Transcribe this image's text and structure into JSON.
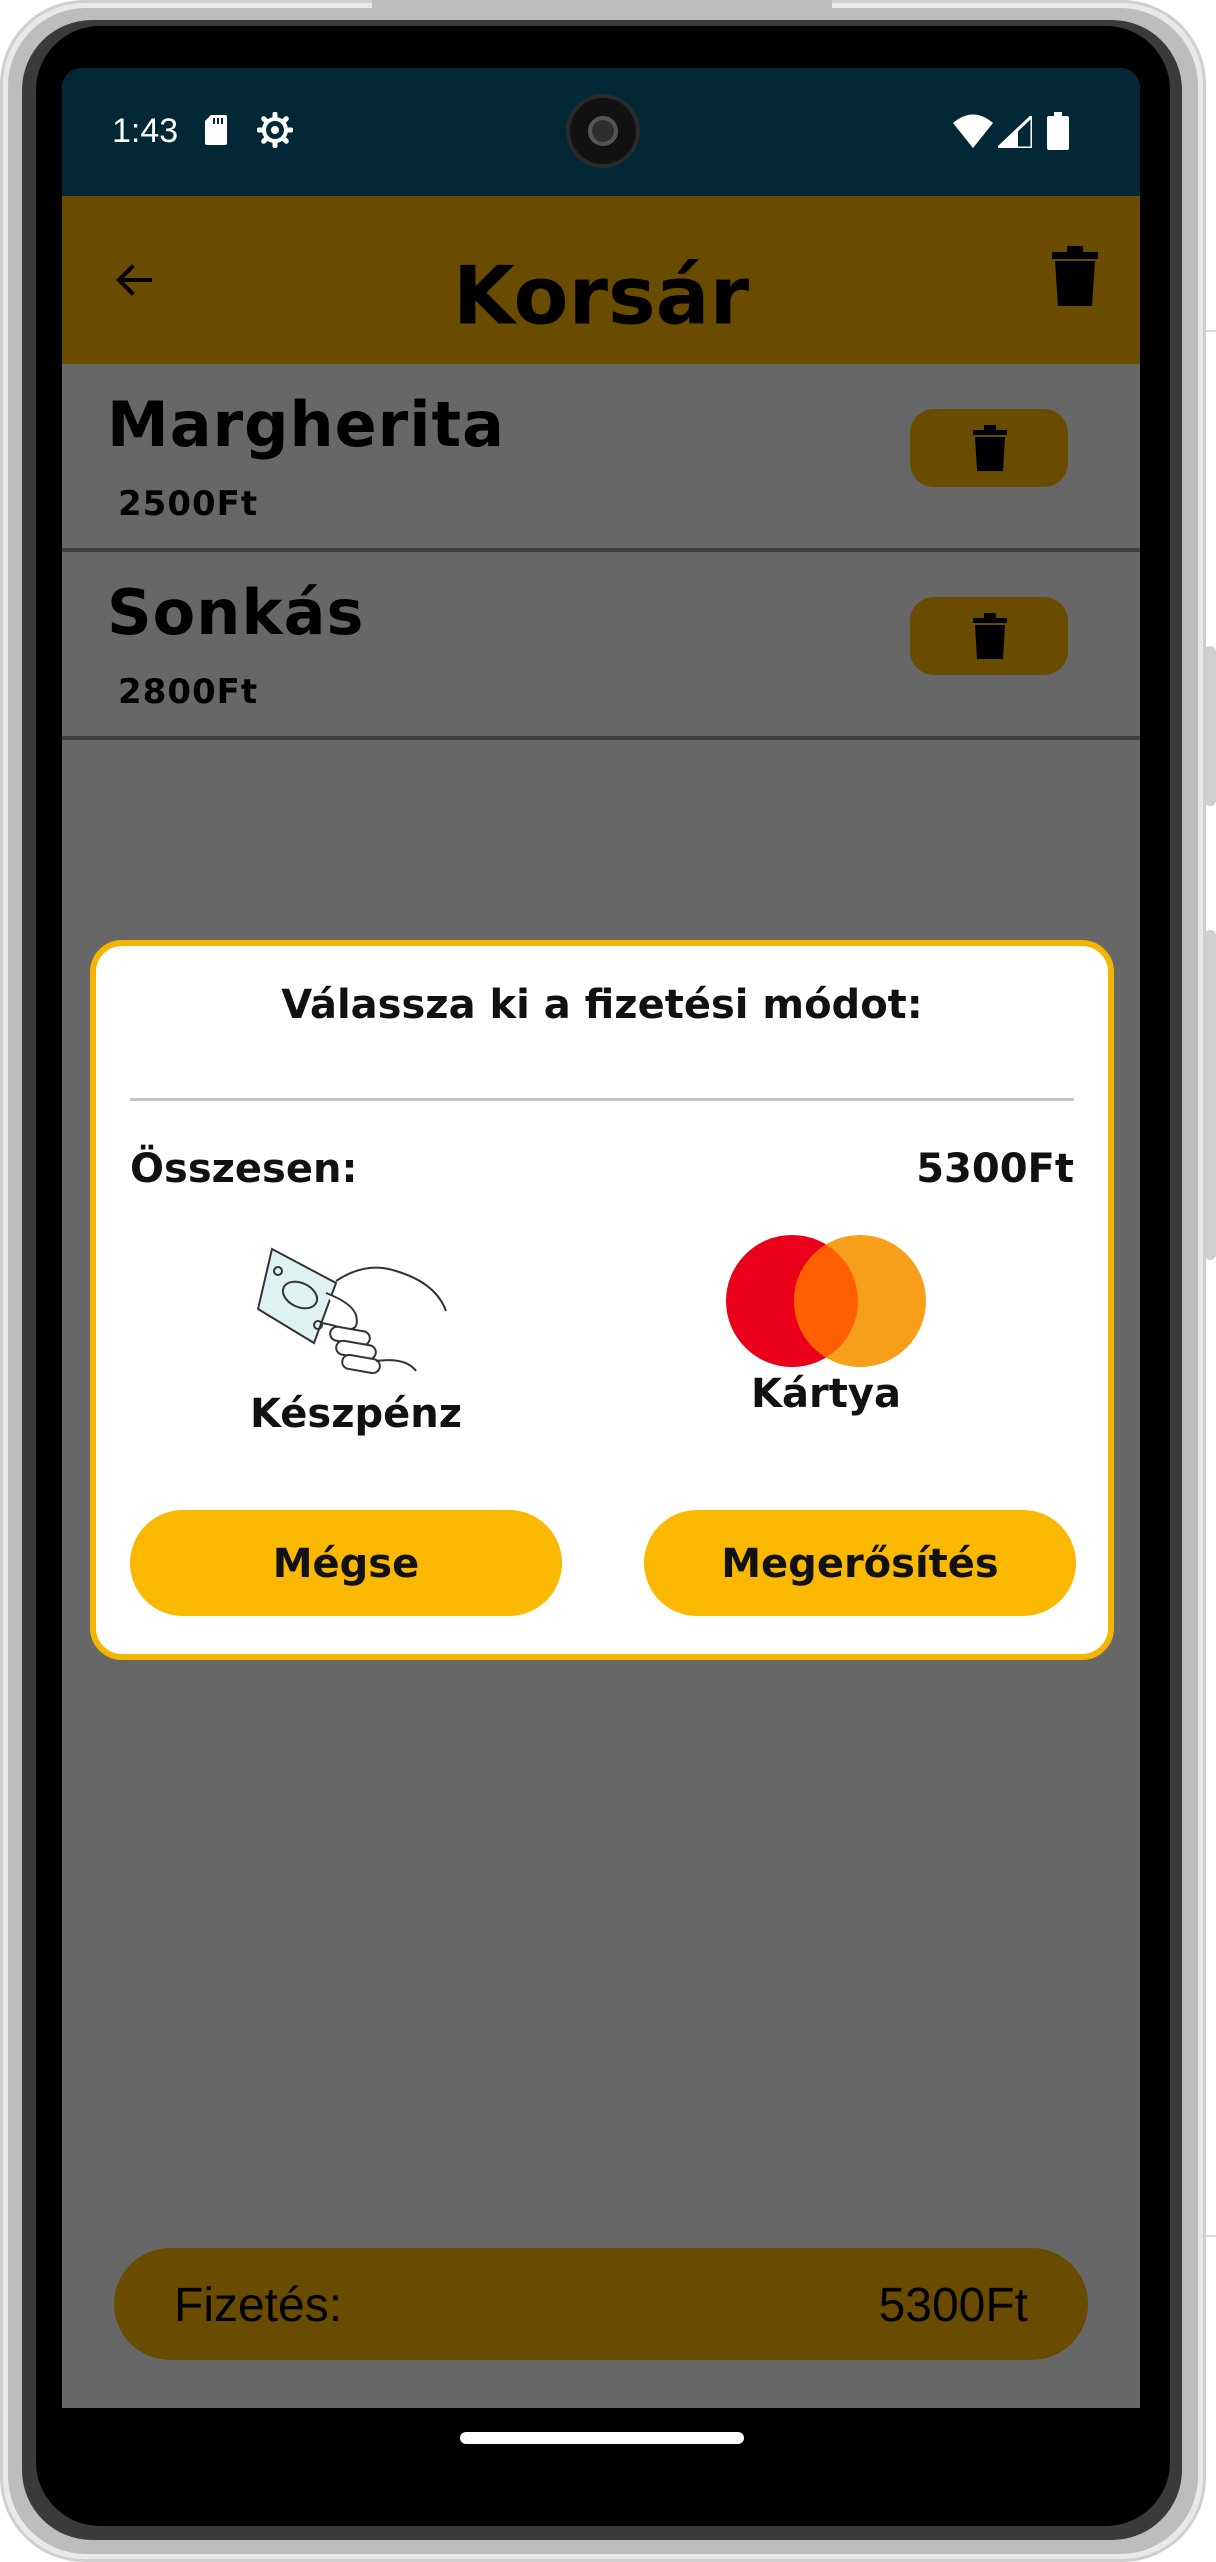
{
  "status_bar": {
    "time": "1:43"
  },
  "app_bar": {
    "title": "Korsár"
  },
  "cart": {
    "items": [
      {
        "name": "Margherita",
        "price": "2500Ft"
      },
      {
        "name": "Sonkás",
        "price": "2800Ft"
      }
    ]
  },
  "payment_bar": {
    "label": "Fizetés:",
    "amount": "5300Ft"
  },
  "dialog": {
    "title": "Válassza ki a fizetési módot:",
    "total_label": "Összesen:",
    "total_value": "5300Ft",
    "methods": [
      {
        "label": "Készpénz",
        "icon": "cash-icon"
      },
      {
        "label": "Kártya",
        "icon": "card-icon"
      }
    ],
    "cancel_label": "Mégse",
    "confirm_label": "Megerősítés"
  },
  "colors": {
    "accent": "#fbb800",
    "app_bar_dimmed": "#694c00",
    "status_bar": "#032835",
    "scrim_background": "#676767",
    "mastercard_red": "#eb001b",
    "mastercard_orange": "#f79e1b"
  }
}
